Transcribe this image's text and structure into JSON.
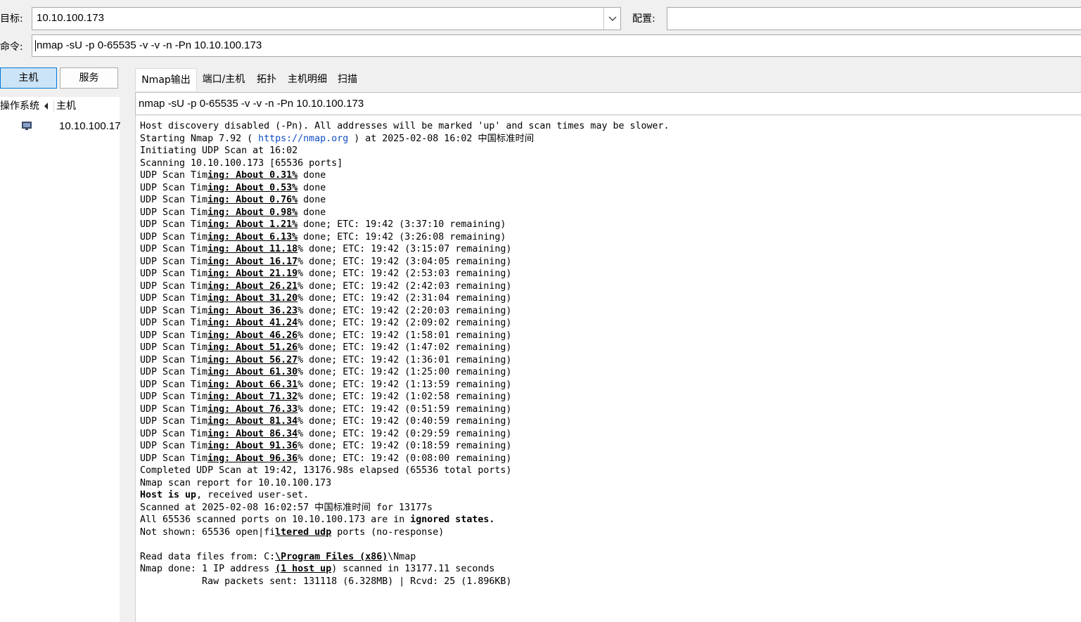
{
  "toolbar": {
    "target_label": "目标:",
    "target_value": "10.10.100.173",
    "profile_label": "配置:",
    "profile_value": "",
    "command_label": "命令:",
    "command_value": "nmap -sU -p 0-65535 -v -v -n -Pn 10.10.100.173"
  },
  "sidebar": {
    "hosts_button": "主机",
    "services_button": "服务",
    "col_os": "操作系统",
    "col_host": "主机",
    "hosts": [
      {
        "os_icon": "unknown-os-icon",
        "address": "10.10.100.17"
      }
    ]
  },
  "tabs": [
    {
      "label": "Nmap输出",
      "active": true
    },
    {
      "label": "端口/主机",
      "active": false
    },
    {
      "label": "拓扑",
      "active": false
    },
    {
      "label": "主机明细",
      "active": false
    },
    {
      "label": "扫描",
      "active": false
    }
  ],
  "output": {
    "command": "nmap -sU -p 0-65535 -v -v -n -Pn 10.10.100.173",
    "lines": [
      [
        {
          "t": "Host discovery disabled (-Pn). All addresses will be marked 'up' and scan times may be slower."
        }
      ],
      [
        {
          "t": "Starting Nmap 7.92 ( "
        },
        {
          "t": "https://nmap.org",
          "s": "link"
        },
        {
          "t": " ) at 2025-02-08 16:02 中国标准时间"
        }
      ],
      [
        {
          "t": "Initiating UDP Scan at 16:02"
        }
      ],
      [
        {
          "t": "Scanning 10.10.100.173 [65536 ports]"
        }
      ],
      [
        {
          "t": "UDP Scan Tim"
        },
        {
          "t": "ing: About 0.31%",
          "s": "u"
        },
        {
          "t": " done"
        }
      ],
      [
        {
          "t": "UDP Scan Tim"
        },
        {
          "t": "ing: About 0.53%",
          "s": "u"
        },
        {
          "t": " done"
        }
      ],
      [
        {
          "t": "UDP Scan Tim"
        },
        {
          "t": "ing: About 0.76%",
          "s": "u"
        },
        {
          "t": " done"
        }
      ],
      [
        {
          "t": "UDP Scan Tim"
        },
        {
          "t": "ing: About 0.98%",
          "s": "u"
        },
        {
          "t": " done"
        }
      ],
      [
        {
          "t": "UDP Scan Tim"
        },
        {
          "t": "ing: About 1.21%",
          "s": "u"
        },
        {
          "t": " done; ETC: 19:42 (3:37:10 remaining)"
        }
      ],
      [
        {
          "t": "UDP Scan Tim"
        },
        {
          "t": "ing: About 6.13%",
          "s": "u"
        },
        {
          "t": " done; ETC: 19:42 (3:26:08 remaining)"
        }
      ],
      [
        {
          "t": "UDP Scan Tim"
        },
        {
          "t": "ing: About 11.18",
          "s": "u"
        },
        {
          "t": "% done; ETC: 19:42 (3:15:07 remaining)"
        }
      ],
      [
        {
          "t": "UDP Scan Tim"
        },
        {
          "t": "ing: About 16.17",
          "s": "u"
        },
        {
          "t": "% done; ETC: 19:42 (3:04:05 remaining)"
        }
      ],
      [
        {
          "t": "UDP Scan Tim"
        },
        {
          "t": "ing: About 21.19",
          "s": "u"
        },
        {
          "t": "% done; ETC: 19:42 (2:53:03 remaining)"
        }
      ],
      [
        {
          "t": "UDP Scan Tim"
        },
        {
          "t": "ing: About 26.21",
          "s": "u"
        },
        {
          "t": "% done; ETC: 19:42 (2:42:03 remaining)"
        }
      ],
      [
        {
          "t": "UDP Scan Tim"
        },
        {
          "t": "ing: About 31.20",
          "s": "u"
        },
        {
          "t": "% done; ETC: 19:42 (2:31:04 remaining)"
        }
      ],
      [
        {
          "t": "UDP Scan Tim"
        },
        {
          "t": "ing: About 36.23",
          "s": "u"
        },
        {
          "t": "% done; ETC: 19:42 (2:20:03 remaining)"
        }
      ],
      [
        {
          "t": "UDP Scan Tim"
        },
        {
          "t": "ing: About 41.24",
          "s": "u"
        },
        {
          "t": "% done; ETC: 19:42 (2:09:02 remaining)"
        }
      ],
      [
        {
          "t": "UDP Scan Tim"
        },
        {
          "t": "ing: About 46.26",
          "s": "u"
        },
        {
          "t": "% done; ETC: 19:42 (1:58:01 remaining)"
        }
      ],
      [
        {
          "t": "UDP Scan Tim"
        },
        {
          "t": "ing: About 51.26",
          "s": "u"
        },
        {
          "t": "% done; ETC: 19:42 (1:47:02 remaining)"
        }
      ],
      [
        {
          "t": "UDP Scan Tim"
        },
        {
          "t": "ing: About 56.27",
          "s": "u"
        },
        {
          "t": "% done; ETC: 19:42 (1:36:01 remaining)"
        }
      ],
      [
        {
          "t": "UDP Scan Tim"
        },
        {
          "t": "ing: About 61.30",
          "s": "u"
        },
        {
          "t": "% done; ETC: 19:42 (1:25:00 remaining)"
        }
      ],
      [
        {
          "t": "UDP Scan Tim"
        },
        {
          "t": "ing: About 66.31",
          "s": "u"
        },
        {
          "t": "% done; ETC: 19:42 (1:13:59 remaining)"
        }
      ],
      [
        {
          "t": "UDP Scan Tim"
        },
        {
          "t": "ing: About 71.32",
          "s": "u"
        },
        {
          "t": "% done; ETC: 19:42 (1:02:58 remaining)"
        }
      ],
      [
        {
          "t": "UDP Scan Tim"
        },
        {
          "t": "ing: About 76.33",
          "s": "u"
        },
        {
          "t": "% done; ETC: 19:42 (0:51:59 remaining)"
        }
      ],
      [
        {
          "t": "UDP Scan Tim"
        },
        {
          "t": "ing: About 81.34",
          "s": "u"
        },
        {
          "t": "% done; ETC: 19:42 (0:40:59 remaining)"
        }
      ],
      [
        {
          "t": "UDP Scan Tim"
        },
        {
          "t": "ing: About 86.34",
          "s": "u"
        },
        {
          "t": "% done; ETC: 19:42 (0:29:59 remaining)"
        }
      ],
      [
        {
          "t": "UDP Scan Tim"
        },
        {
          "t": "ing: About 91.36",
          "s": "u"
        },
        {
          "t": "% done; ETC: 19:42 (0:18:59 remaining)"
        }
      ],
      [
        {
          "t": "UDP Scan Tim"
        },
        {
          "t": "ing: About 96.36",
          "s": "u"
        },
        {
          "t": "% done; ETC: 19:42 (0:08:00 remaining)"
        }
      ],
      [
        {
          "t": "Completed UDP Scan at 19:42, 13176.98s elapsed (65536 total ports)"
        }
      ],
      [
        {
          "t": "Nmap scan report for 10.10.100.173"
        }
      ],
      [
        {
          "t": "Host is up",
          "s": "b"
        },
        {
          "t": ", received user-set."
        }
      ],
      [
        {
          "t": "Scanned at 2025-02-08 16:02:57 中国标准时间 for 13177s"
        }
      ],
      [
        {
          "t": "All 65536 scanned ports on 10.10.100.173 are in "
        },
        {
          "t": "ignored states.",
          "s": "b"
        }
      ],
      [
        {
          "t": "Not shown: 65536 open|fi"
        },
        {
          "t": "ltered udp",
          "s": "u"
        },
        {
          "t": " ports (no-response)"
        }
      ],
      [
        {
          "t": ""
        }
      ],
      [
        {
          "t": "Read data files from: C:"
        },
        {
          "t": "\\Program Files (x86)",
          "s": "u"
        },
        {
          "t": "\\Nmap"
        }
      ],
      [
        {
          "t": "Nmap done: 1 IP address "
        },
        {
          "t": "(1 host up",
          "s": "u"
        },
        {
          "t": ") scanned in 13177.11 seconds"
        }
      ],
      [
        {
          "t": "           Raw packets sent: 131118 (6.328MB) | Rcvd: 25 (1.896KB)"
        }
      ]
    ]
  }
}
